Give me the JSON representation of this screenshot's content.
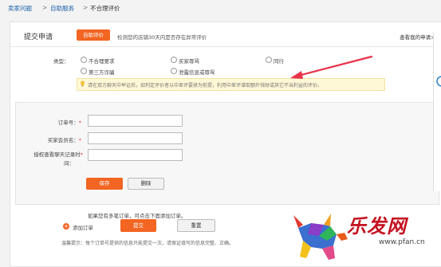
{
  "breadcrumb": {
    "items": [
      "卖家问题",
      "自助服务",
      "不合理评价"
    ],
    "separator": ">"
  },
  "header": {
    "title": "提交申请",
    "appeal_button": "自助评价",
    "detect_text": "检测您的店铺30天内是否存在异常评价",
    "my_applications": "查看我的申请>>"
  },
  "type_section": {
    "label": "类型：",
    "options": [
      "不合理要求",
      "买家辱骂",
      "同行",
      "第三方诈骗",
      "泄露信息或辱骂"
    ]
  },
  "tip": {
    "text": "请在双方聊天中举证后，如判定评价者以中差评要挟为前提，利用中差评谋取额外钱财或其它不当利益的评价。"
  },
  "form": {
    "order_label": "订单号：",
    "buyer_label": "买家会员名：",
    "auth_label_line1": "授权查看聊天记录时",
    "auth_label_line2": "间：",
    "required_mark": "*",
    "save_button": "保存",
    "delete_button": "删除"
  },
  "footer": {
    "multi_order_note": "如果您有多笔订单，可点击下面添加订单。",
    "add_order_label": "添加订单",
    "submit_button": "提交",
    "reset_button": "重置",
    "warm_tip": "温馨提示：每个订单号提供的信息只能提交一次，请保证填写的信息完整、正确。"
  },
  "watermark": {
    "brand": "乐发网",
    "url": "www.pfan.cn"
  },
  "colors": {
    "accent": "#f26522",
    "link": "#1a5fa8",
    "arrow": "#e8334a",
    "tip_bg": "#fff8d6"
  }
}
